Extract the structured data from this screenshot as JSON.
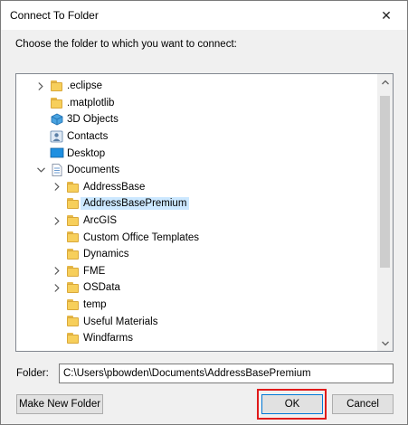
{
  "window": {
    "title": "Connect To Folder",
    "close_glyph": "✕"
  },
  "prompt": "Choose the folder to which you want to connect:",
  "tree": [
    {
      "label": ".eclipse",
      "icon": "folder-icon",
      "expander": "collapsed",
      "level": 1,
      "selected": false
    },
    {
      "label": ".matplotlib",
      "icon": "folder-icon",
      "expander": "none",
      "level": 1,
      "selected": false
    },
    {
      "label": "3D Objects",
      "icon": "3d-objects-icon",
      "expander": "none",
      "level": 1,
      "selected": false
    },
    {
      "label": "Contacts",
      "icon": "contacts-icon",
      "expander": "none",
      "level": 1,
      "selected": false
    },
    {
      "label": "Desktop",
      "icon": "desktop-icon",
      "expander": "none",
      "level": 1,
      "selected": false
    },
    {
      "label": "Documents",
      "icon": "documents-icon",
      "expander": "expanded",
      "level": 1,
      "selected": false
    },
    {
      "label": "AddressBase",
      "icon": "folder-icon",
      "expander": "collapsed",
      "level": 2,
      "selected": false
    },
    {
      "label": "AddressBasePremium",
      "icon": "folder-icon",
      "expander": "none",
      "level": 2,
      "selected": true
    },
    {
      "label": "ArcGIS",
      "icon": "folder-icon",
      "expander": "collapsed",
      "level": 2,
      "selected": false
    },
    {
      "label": "Custom Office Templates",
      "icon": "folder-icon",
      "expander": "none",
      "level": 2,
      "selected": false
    },
    {
      "label": "Dynamics",
      "icon": "folder-icon",
      "expander": "none",
      "level": 2,
      "selected": false
    },
    {
      "label": "FME",
      "icon": "folder-icon",
      "expander": "collapsed",
      "level": 2,
      "selected": false
    },
    {
      "label": "OSData",
      "icon": "folder-icon",
      "expander": "collapsed",
      "level": 2,
      "selected": false
    },
    {
      "label": "temp",
      "icon": "folder-icon",
      "expander": "none",
      "level": 2,
      "selected": false
    },
    {
      "label": "Useful Materials",
      "icon": "folder-icon",
      "expander": "none",
      "level": 2,
      "selected": false
    },
    {
      "label": "Windfarms",
      "icon": "folder-icon",
      "expander": "none",
      "level": 2,
      "selected": false
    }
  ],
  "folder": {
    "label": "Folder:",
    "value": "C:\\Users\\pbowden\\Documents\\AddressBasePremium"
  },
  "buttons": {
    "new_folder": "Make New Folder",
    "ok": "OK",
    "cancel": "Cancel"
  },
  "colors": {
    "selection": "#cce8ff",
    "highlight_box": "#e01a1a",
    "folder_yellow": "#f7cf5b"
  }
}
